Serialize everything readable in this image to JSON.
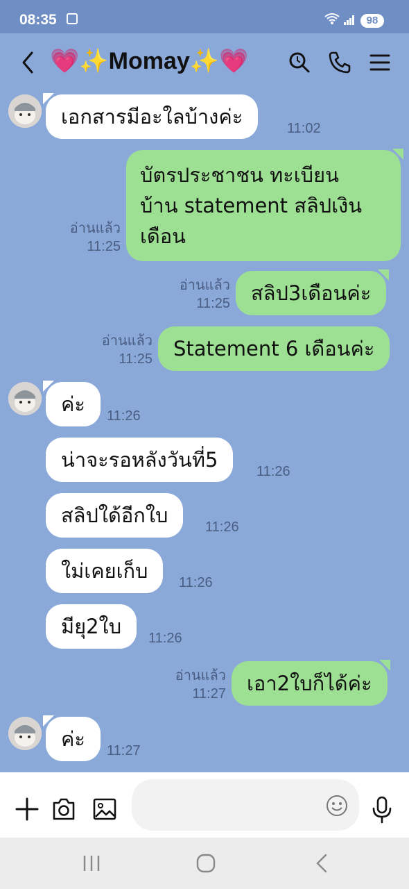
{
  "status": {
    "time": "08:35",
    "battery": "98"
  },
  "header": {
    "title": "💗✨Momay✨💗"
  },
  "messages": [
    {
      "side": "in",
      "text": "เอกสารมีอะใลบ้างค่ะ",
      "time": "11:02"
    },
    {
      "side": "out",
      "lines": [
        "บัตรประชาชน ทะเบียน",
        "บ้าน statement สลิปเงิน",
        "เดือน"
      ],
      "read": "อ่านแล้ว",
      "time": "11:25"
    },
    {
      "side": "out",
      "text": "สลิป3เดือนค่ะ",
      "read": "อ่านแล้ว",
      "time": "11:25"
    },
    {
      "side": "out",
      "text": "Statement 6 เดือนค่ะ",
      "read": "อ่านแล้ว",
      "time": "11:25"
    },
    {
      "side": "in",
      "text": "ค่ะ",
      "time": "11:26"
    },
    {
      "side": "in",
      "text": "น่าจะรอหลังวันที่5",
      "time": "11:26"
    },
    {
      "side": "in",
      "text": "สลิปใด้อีกใบ",
      "time": "11:26"
    },
    {
      "side": "in",
      "text": "ใม่เคยเก็บ",
      "time": "11:26"
    },
    {
      "side": "in",
      "text": "มียุ2ใบ",
      "time": "11:26"
    },
    {
      "side": "out",
      "text": "เอา2ใบก็ได้ค่ะ",
      "read": "อ่านแล้ว",
      "time": "11:27"
    },
    {
      "side": "in",
      "text": "ค่ะ",
      "time": "11:27"
    }
  ],
  "icons": {
    "back": "chevron-left-icon",
    "search": "search-icon",
    "call": "phone-icon",
    "menu": "menu-icon",
    "plus": "plus-icon",
    "camera": "camera-icon",
    "image": "image-icon",
    "emoji": "emoji-icon",
    "mic": "microphone-icon"
  },
  "colors": {
    "background": "#8aa9d9",
    "outgoing": "#9ee093",
    "incoming": "#ffffff",
    "statusbar": "#6f8fc4"
  }
}
